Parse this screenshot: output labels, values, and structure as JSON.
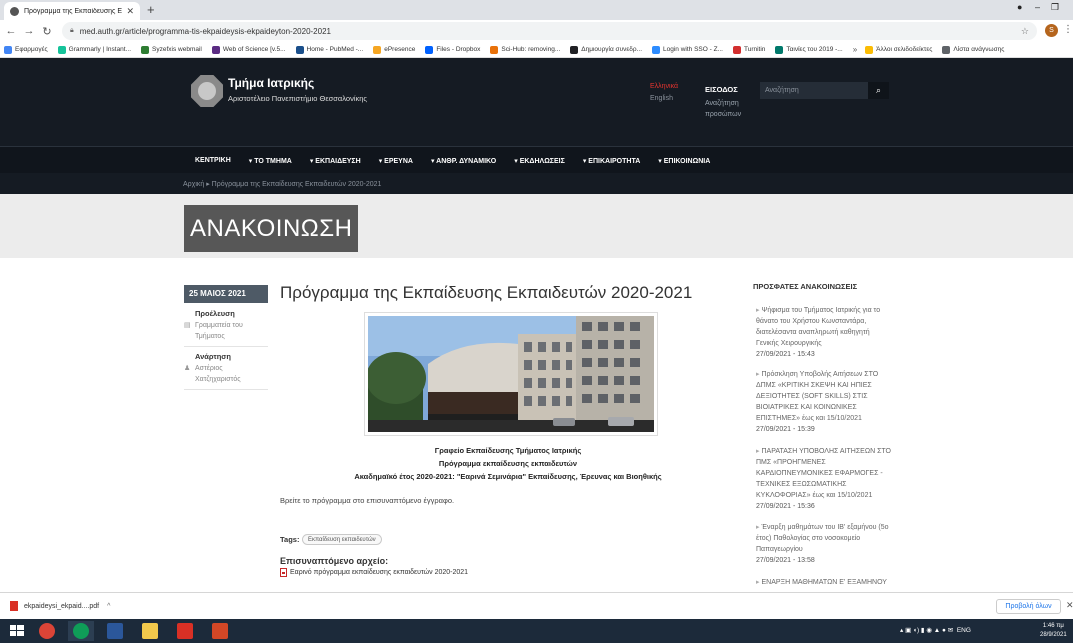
{
  "browser": {
    "tab_title": "Πρόγραμμα της Εκπαίδευσης Εκ",
    "tab_close": "✕",
    "new_tab": "+",
    "url": "med.auth.gr/article/programma-tis-ekpaideysis-ekpaideyton-2020-2021",
    "profile_initial": "S",
    "bookmarks": [
      {
        "label": "Εφαρμογές",
        "color": "#4285f4"
      },
      {
        "label": "Grammarly | Instant...",
        "color": "#15c39a"
      },
      {
        "label": "Syzefxis webmail",
        "color": "#2e7d32"
      },
      {
        "label": "Web of Science [v.5...",
        "color": "#5b2c83"
      },
      {
        "label": "Home - PubMed -...",
        "color": "#1a4f8b"
      },
      {
        "label": "ePresence",
        "color": "#f5a623"
      },
      {
        "label": "Files - Dropbox",
        "color": "#0061fe"
      },
      {
        "label": "Sci-Hub: removing...",
        "color": "#e8710a"
      },
      {
        "label": "Δημιουργία συνεδρ...",
        "color": "#202124"
      },
      {
        "label": "Login with SSO - Z...",
        "color": "#2d8cff"
      },
      {
        "label": "Turnitin",
        "color": "#d32f2f"
      },
      {
        "label": "Ταινίες του 2019 -...",
        "color": "#00796b"
      }
    ],
    "bookmarks_more": "»",
    "bookmarks_other": [
      {
        "label": "Άλλοι σελιδοδείκτες",
        "color": "#fbbc04"
      },
      {
        "label": "Λίστα ανάγνωσης",
        "color": "#5f6368"
      }
    ]
  },
  "header": {
    "title": "Τμήμα Ιατρικής",
    "subtitle": "Αριστοτέλειο Πανεπιστήμιο Θεσσαλονίκης",
    "lang_active": "Ελληνικά",
    "lang_other": "English",
    "login_label": "ΕΙΣΟΔΟΣ",
    "login_desc": "Αναζήτηση προσώπων",
    "search_placeholder": "Αναζήτηση"
  },
  "nav": {
    "items": [
      "ΚΕΝΤΡΙΚΗ",
      "▾ ΤΟ ΤΜΗΜΑ",
      "▾ ΕΚΠΑΙΔΕΥΣΗ",
      "▾ ΕΡΕΥΝΑ",
      "▾ ΑΝΘΡ. ΔΥΝΑΜΙΚΟ",
      "▾ ΕΚΔΗΛΩΣΕΙΣ",
      "▾ ΕΠΙΚΑΙΡΟΤΗΤΑ",
      "▾ ΕΠΙΚΟΙΝΩΝΙΑ"
    ]
  },
  "breadcrumb": "Αρχική ▸ Πρόγραμμα της Εκπαίδευσης Εκπαιδευτών 2020-2021",
  "page_title": "ΑΝΑΚΟΙΝΩΣΗ",
  "article": {
    "date": "25 ΜΑΙΟΣ 2021",
    "origin_label": "Προέλευση",
    "origin_value": "Γραμματεία του Τμήματος",
    "post_label": "Ανάρτηση",
    "post_value": "Αστέριος Χατζηχαριστός",
    "title": "Πρόγραμμα της Εκπαίδευσης Εκπαιδευτών 2020-2021",
    "caption_1": "Γραφείο Εκπαίδευσης Τμήματος Ιατρικής",
    "caption_2": "Πρόγραμμα εκπαίδευσης εκπαιδευτών",
    "caption_3": "Ακαδημαϊκό έτος 2020-2021: \"Εαρινά Σεμινάρια\" Εκπαίδευσης, Έρευνας και Βιοηθικής",
    "body": "Βρείτε το πρόγραμμα στο επισυναπτόμενο έγγραφο.",
    "tags_label": "Tags:",
    "tag": "Εκπαίδευση εκπαιδευτών",
    "attachment_heading": "Επισυναπτόμενο αρχείο:",
    "attachment_name": "Εαρινό πρόγραμμα εκπαίδευσης εκπαιδευτών 2020-2021"
  },
  "sidebar": {
    "heading": "ΠΡΟΣΦΑΤΕΣ ΑΝΑΚΟΙΝΩΣΕΙΣ",
    "items": [
      {
        "title": "Ψήφισμα του Τμήματος Ιατρικής για το θάνατο του Χρήστου Κωνσταντάρα, διατελέσαντα αναπληρωτή καθηγητή Γενικής Χειρουργικής",
        "date": "27/09/2021 - 15:43"
      },
      {
        "title": "Πρόσκληση Υποβολής Αιτήσεων ΣΤΟ ΔΠΜΣ «ΚΡΙΤΙΚΗ ΣΚΕΨΗ ΚΑΙ ΗΠΙΕΣ ΔΕΞΙΟΤΗΤΕΣ (SOFT SKILLS) ΣΤΙΣ ΒΙΟΙΑΤΡΙΚΕΣ ΚΑΙ ΚΟΙΝΩΝΙΚΕΣ ΕΠΙΣΤΗΜΕΣ» έως και 15/10/2021",
        "date": "27/09/2021 - 15:39"
      },
      {
        "title": "ΠΑΡΑΤΑΣΗ ΥΠΟΒΟΛΗΣ ΑΙΤΗΣΕΩΝ ΣΤΟ ΠΜΣ «ΠΡΟΗΓΜΕΝΕΣ ΚΑΡΔΙΟΠΝΕΥΜΟΝΙΚΕΣ ΕΦΑΡΜΟΓΕΣ - ΤΕΧΝΙΚΕΣ ΕΞΩΣΩΜΑΤΙΚΗΣ ΚΥΚΛΟΦΟΡΙΑΣ» έως και 15/10/2021",
        "date": "27/09/2021 - 15:36"
      },
      {
        "title": "Έναρξη μαθημάτων του ΙΒ' εξαμήνου (5ο έτος) Παθολογίας στο νοσοκομείο Παπαγεωργίου",
        "date": "27/09/2021 - 13:58"
      },
      {
        "title": "ΕΝΑΡΞΗ ΜΑΘΗΜΑΤΩΝ Ε' ΕΞΑΜΗΝΟΥ",
        "date": ""
      }
    ]
  },
  "downloads": {
    "file": "ekpaideysi_ekpaid....pdf",
    "show_all": "Προβολή όλων"
  },
  "taskbar": {
    "lang": "ENG",
    "time": "1:46 πμ",
    "date": "28/9/2021"
  },
  "colors": {
    "header_bg": "#151b23",
    "accent_red": "#e3342f",
    "title_band": "#575757",
    "date_badge": "#4e5a66"
  }
}
